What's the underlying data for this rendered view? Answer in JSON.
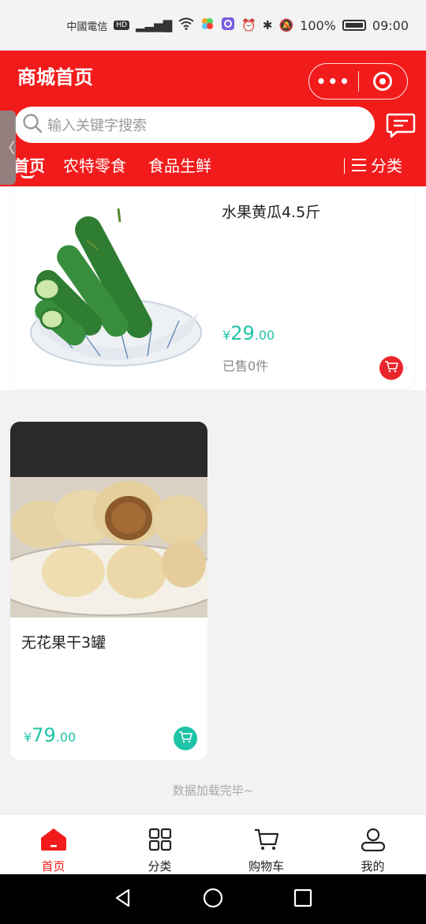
{
  "status_bar": {
    "carrier": "中國電信",
    "hd": "HD",
    "signal": "4G",
    "battery": "100%",
    "time": "09:00"
  },
  "header": {
    "title": "商城首页",
    "search_placeholder": "输入关键字搜索",
    "tabs": [
      {
        "label": "首页",
        "active": true
      },
      {
        "label": "农特零食",
        "active": false
      },
      {
        "label": "食品生鲜",
        "active": false
      }
    ],
    "category_label": "分类",
    "side_tab_label": "〈"
  },
  "products": [
    {
      "name": "水果黄瓜4.5斤",
      "price_symbol": "¥",
      "price_int": "29",
      "price_dec": ".00",
      "sold": "已售0件",
      "cart_color": "#e8262a"
    },
    {
      "name": "无花果干3罐",
      "price_symbol": "¥",
      "price_int": "79",
      "price_dec": ".00",
      "cart_color": "#1fc3a6"
    }
  ],
  "end_text": "数据加载完毕~",
  "bottom_nav": [
    {
      "label": "首页",
      "icon": "home-icon",
      "active": true
    },
    {
      "label": "分类",
      "icon": "grid-icon",
      "active": false
    },
    {
      "label": "购物车",
      "icon": "cart-icon",
      "active": false
    },
    {
      "label": "我的",
      "icon": "user-icon",
      "active": false
    }
  ],
  "colors": {
    "brand_red": "#f21b1b",
    "price_green": "#1fc3a6"
  }
}
